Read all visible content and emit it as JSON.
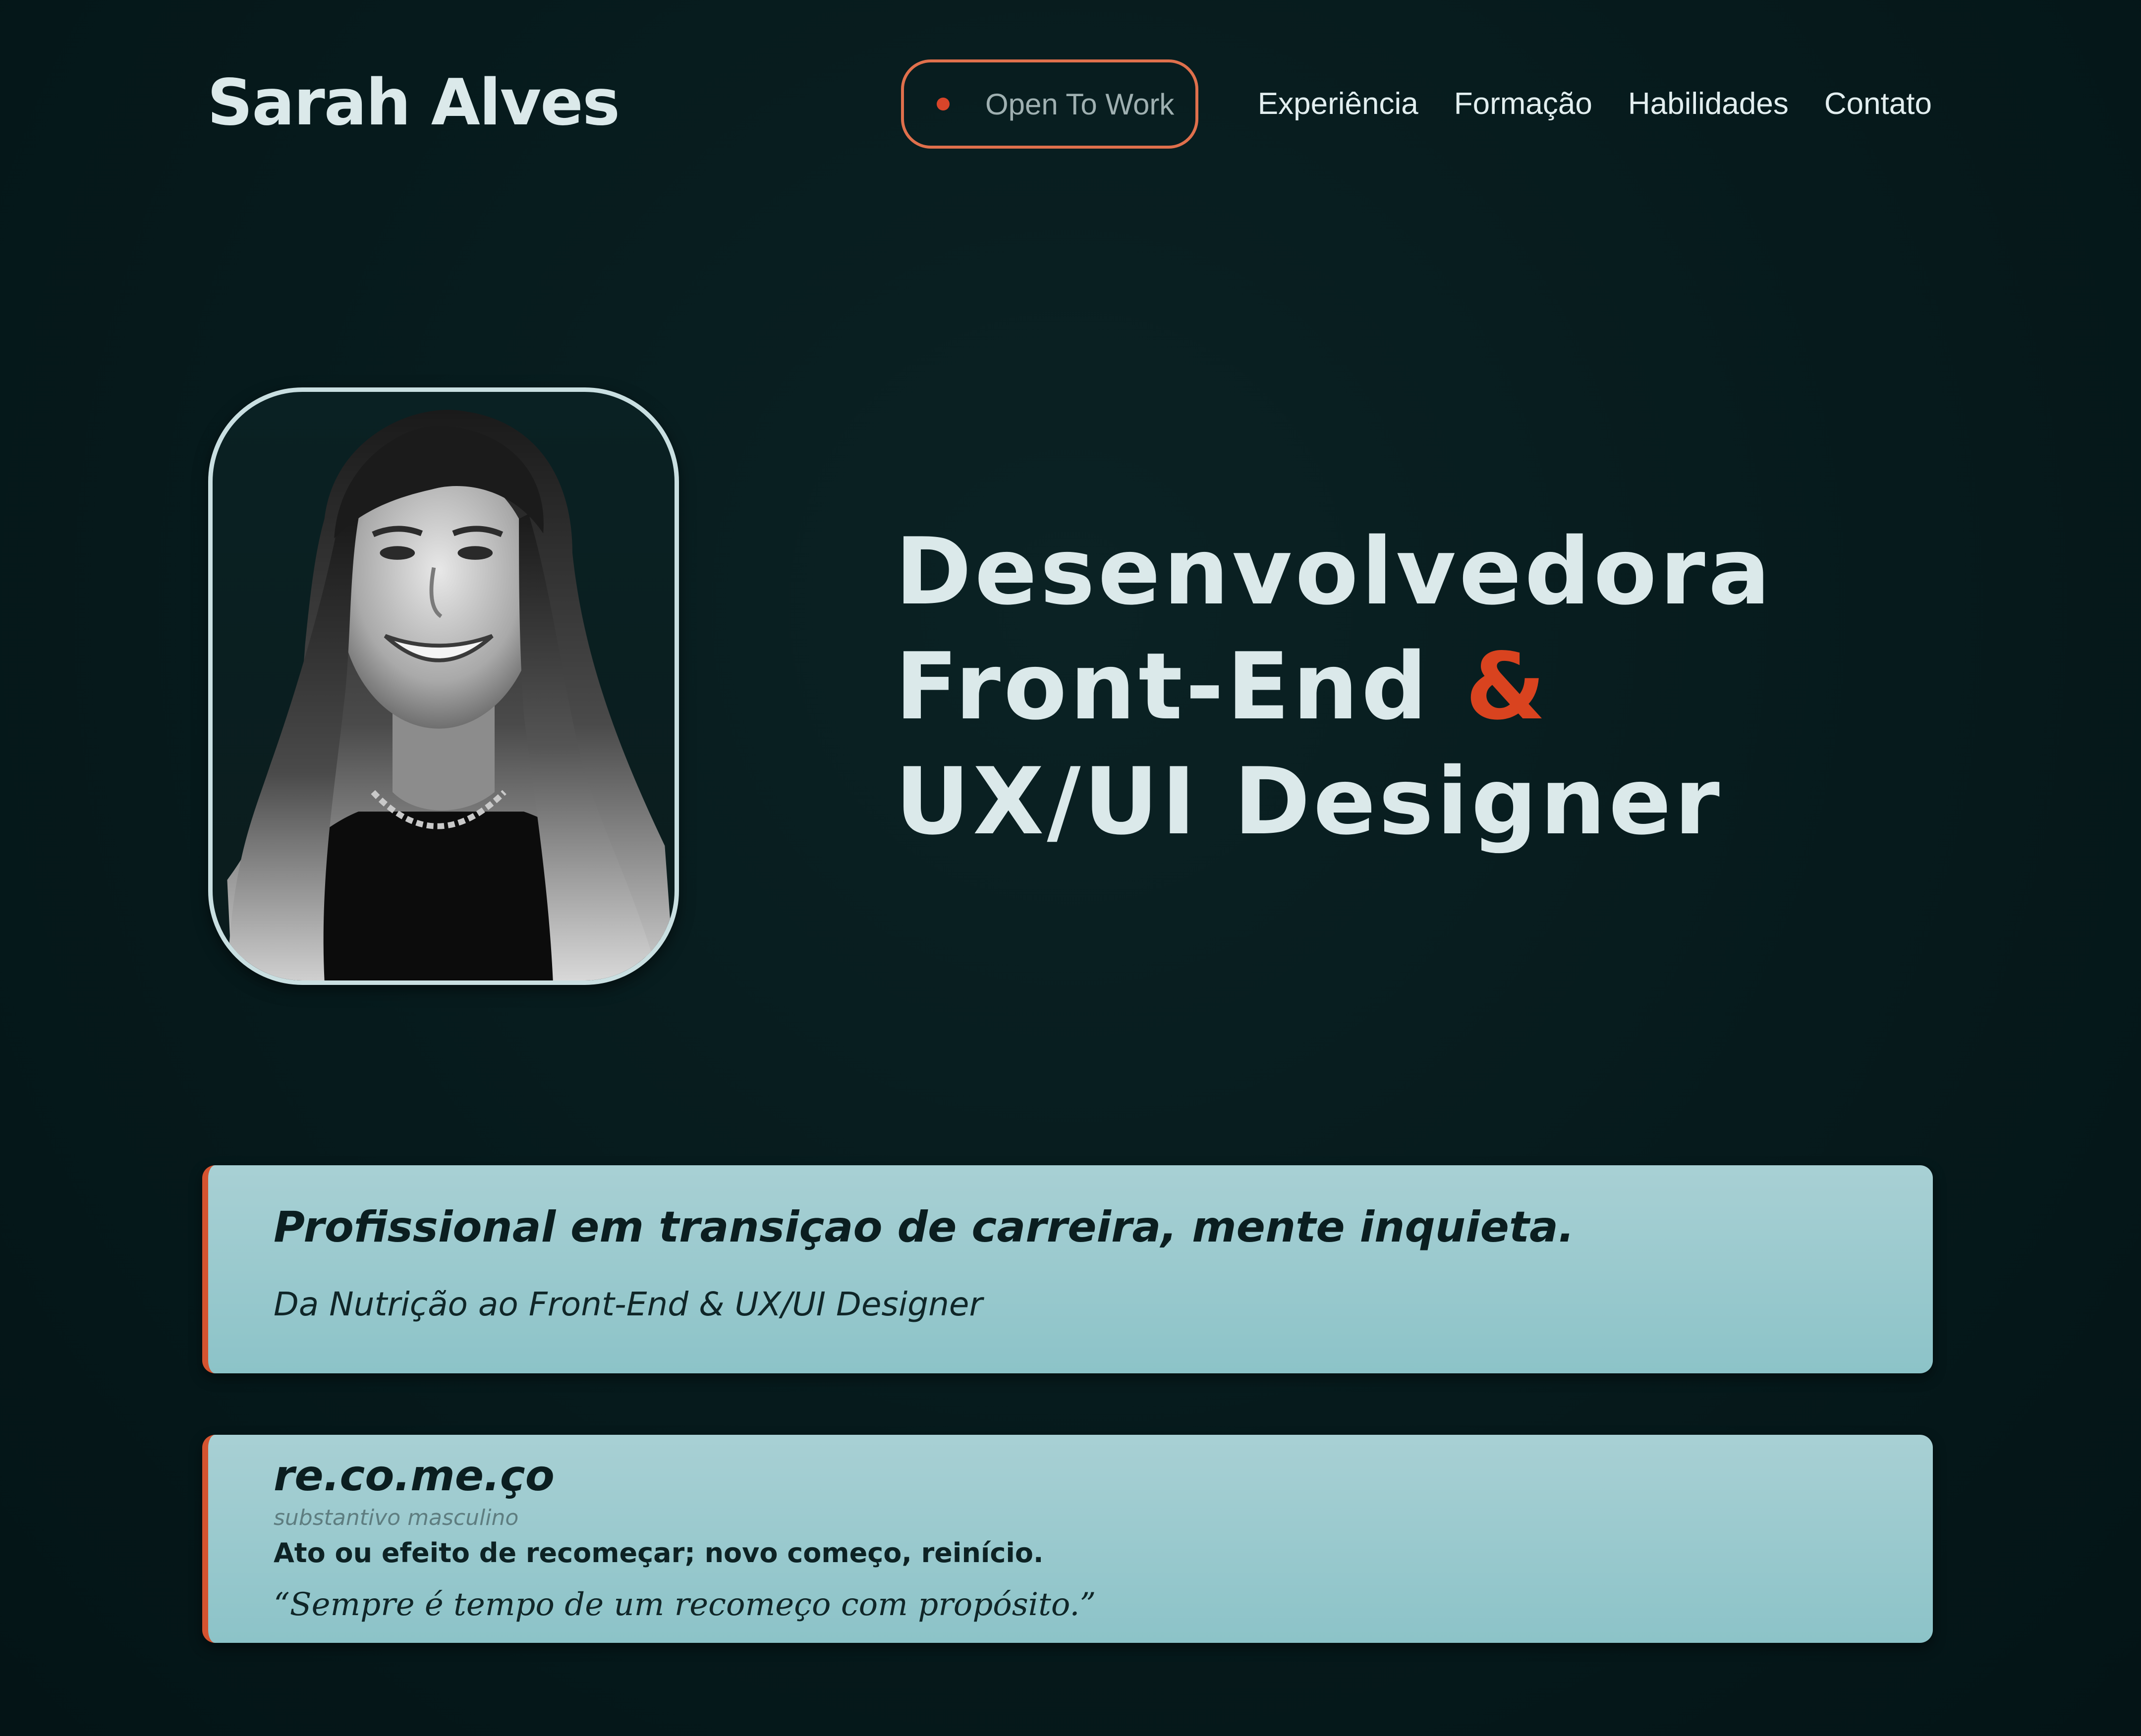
{
  "header": {
    "logo": "Sarah Alves",
    "status_badge": "Open To Work",
    "nav": [
      "Experiência",
      "Formação",
      "Habilidades",
      "Contato"
    ]
  },
  "hero": {
    "line1": "Desenvolvedora",
    "line2": "Front-End",
    "amp": "&",
    "line3": "UX/UI Designer",
    "photo": "portrait-photo"
  },
  "about_card": {
    "headline": "Profissional em transiçao de carreira, mente inquieta.",
    "subtitle": "Da Nutrição ao Front-End & UX/UI Designer"
  },
  "definition_card": {
    "word": "re.co.me.ço",
    "word_class": "substantivo masculino",
    "definition": "Ato ou efeito de recomeçar; novo começo, reinício.",
    "quote": "“Sempre é tempo de um recomeço com propósito.”"
  },
  "colors": {
    "background": "#061a1c",
    "text": "#dbe9ea",
    "accent": "#d9431f",
    "pill_border": "#e0704c",
    "card_bg": "#a8d0d4"
  }
}
